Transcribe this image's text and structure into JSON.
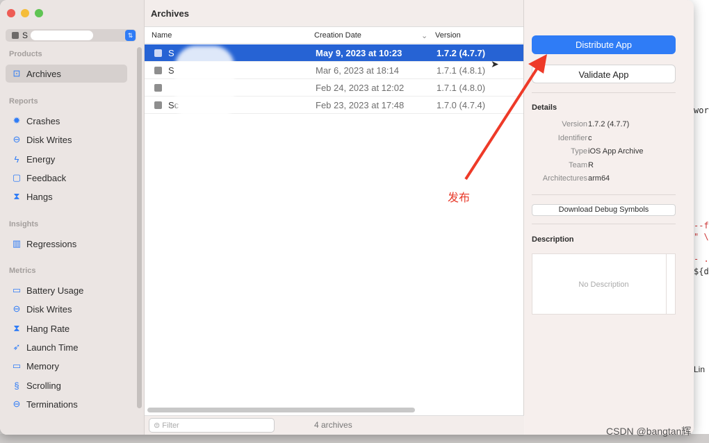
{
  "sidebar": {
    "scheme_text": "S",
    "sections": {
      "products": "Products",
      "reports": "Reports",
      "insights": "Insights",
      "metrics": "Metrics"
    },
    "items": [
      {
        "label": "Archives",
        "icon": "archive-icon",
        "selected": true
      },
      {
        "label": "Crashes",
        "icon": "crash-icon"
      },
      {
        "label": "Disk Writes",
        "icon": "disk-icon"
      },
      {
        "label": "Energy",
        "icon": "bolt-icon"
      },
      {
        "label": "Feedback",
        "icon": "message-icon"
      },
      {
        "label": "Hangs",
        "icon": "hourglass-icon"
      },
      {
        "label": "Regressions",
        "icon": "chart-icon"
      },
      {
        "label": "Battery Usage",
        "icon": "battery-icon"
      },
      {
        "label": "Disk Writes",
        "icon": "disk-icon"
      },
      {
        "label": "Hang Rate",
        "icon": "hourglass-icon"
      },
      {
        "label": "Launch Time",
        "icon": "rocket-icon"
      },
      {
        "label": "Memory",
        "icon": "memory-icon"
      },
      {
        "label": "Scrolling",
        "icon": "scroll-icon"
      },
      {
        "label": "Terminations",
        "icon": "minus-circle-icon"
      }
    ]
  },
  "main": {
    "title": "Archives",
    "columns": [
      "Name",
      "Creation Date",
      "Version"
    ],
    "rows": [
      {
        "name": "S",
        "date": "May 9, 2023 at 10:23",
        "version": "1.7.2 (4.7.7)",
        "selected": true
      },
      {
        "name": "S",
        "date": "Mar 6, 2023 at 18:14",
        "version": "1.7.1 (4.8.1)"
      },
      {
        "name": "",
        "date": "Feb 24, 2023 at 12:02",
        "version": "1.7.1 (4.8.0)"
      },
      {
        "name": "Sc",
        "date": "Feb 23, 2023 at 17:48",
        "version": "1.7.0 (4.7.4)"
      }
    ],
    "filter_placeholder": "Filter",
    "count": "4 archives"
  },
  "right": {
    "distribute": "Distribute App",
    "validate": "Validate App",
    "details_title": "Details",
    "details": [
      {
        "k": "Version",
        "v": "1.7.2 (4.7.7)"
      },
      {
        "k": "Identifier",
        "v": "c"
      },
      {
        "k": "Type",
        "v": "iOS App Archive"
      },
      {
        "k": "Team",
        "v": "R"
      },
      {
        "k": "Architectures",
        "v": "arm64"
      }
    ],
    "debug_symbols": "Download Debug Symbols",
    "description_title": "Description",
    "no_description": "No Description"
  },
  "background": {
    "lines": [
      "work",
      "--f",
      "\" \\",
      "- .",
      "${de",
      "Lin"
    ]
  },
  "annotation": "发布",
  "watermark": "CSDN @bangtan辉"
}
